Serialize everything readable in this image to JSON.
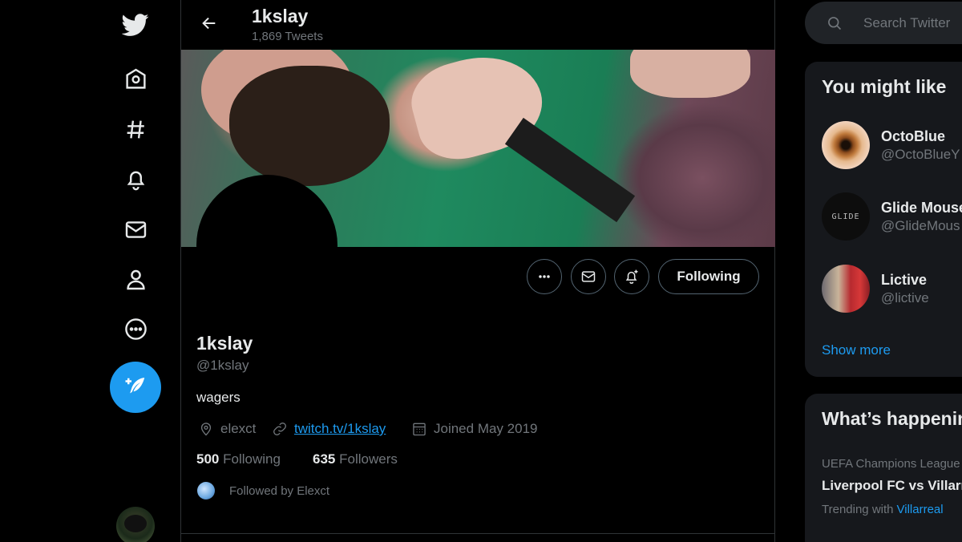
{
  "nav": {
    "items": [
      {
        "name": "twitter-logo-icon",
        "label": "Twitter"
      },
      {
        "name": "home-icon",
        "label": "Home"
      },
      {
        "name": "explore-hashtag-icon",
        "label": "Explore"
      },
      {
        "name": "notifications-bell-icon",
        "label": "Notifications"
      },
      {
        "name": "messages-envelope-icon",
        "label": "Messages"
      },
      {
        "name": "profile-person-icon",
        "label": "Profile"
      },
      {
        "name": "more-options-icon",
        "label": "More"
      }
    ],
    "compose_icon": "compose-feather-icon"
  },
  "header": {
    "name": "1kslay",
    "tweet_count": "1,869 Tweets"
  },
  "profile": {
    "display_name": "1kslay",
    "handle": "@1kslay",
    "bio": "wagers",
    "location": "elexct",
    "website": "twitch.tv/1kslay",
    "joined": "Joined May 2019",
    "following_count": "500",
    "following_label": "Following",
    "followers_count": "635",
    "followers_label": "Followers",
    "followed_by": "Followed by Elexct",
    "follow_button_label": "Following"
  },
  "search": {
    "placeholder": "Search Twitter"
  },
  "suggestions": {
    "title": "You might like",
    "users": [
      {
        "name": "OctoBlue",
        "handle": "@OctoBlueY"
      },
      {
        "name": "Glide Mouse",
        "handle": "@GlideMous"
      },
      {
        "name": "Lictive",
        "handle": "@lictive"
      }
    ],
    "show_more": "Show more"
  },
  "trends": {
    "title": "What’s happening",
    "items": [
      {
        "category": "UEFA Champions League",
        "title": "Liverpool FC vs Villarreal",
        "trending_with_label": "Trending with",
        "trending_with": "Villarreal"
      }
    ]
  },
  "colors": {
    "accent": "#1d9bf0",
    "background": "#000000",
    "text_primary": "#e7e9ea",
    "text_secondary": "#71767b"
  }
}
